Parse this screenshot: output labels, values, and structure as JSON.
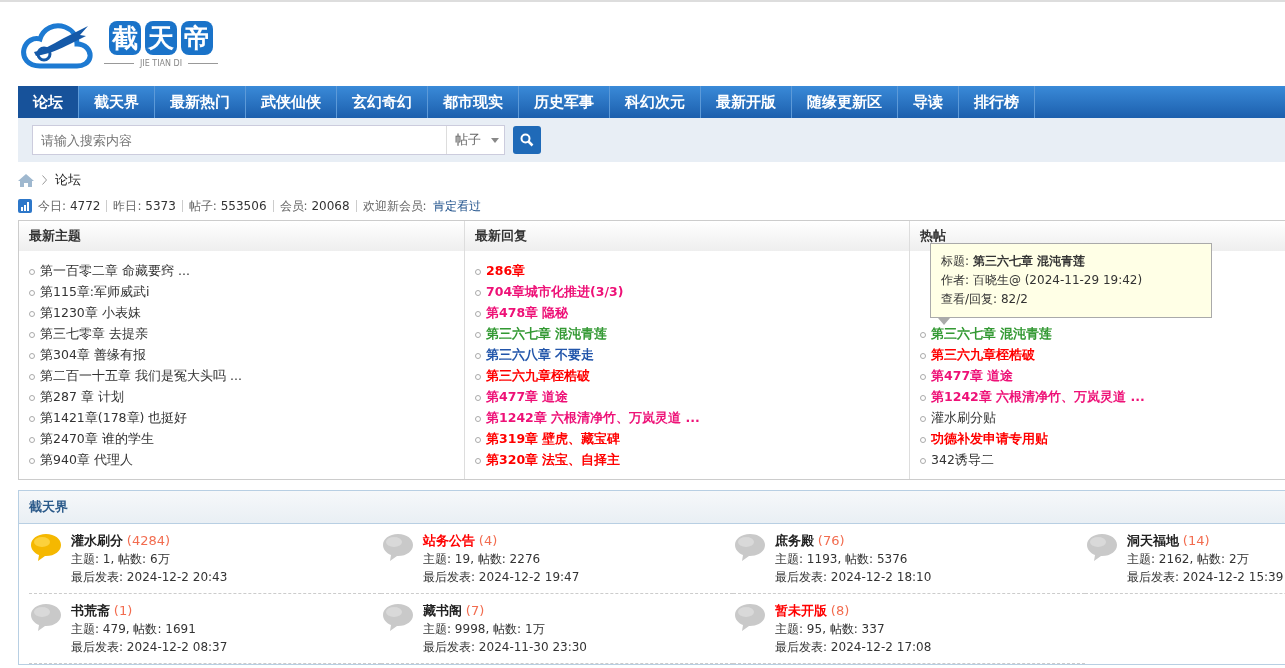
{
  "logo": {
    "chars": [
      "截",
      "天",
      "帝"
    ],
    "subtitle": "JIE TIAN DI"
  },
  "nav": [
    {
      "label": "论坛",
      "selected": true
    },
    {
      "label": "截天界",
      "selected": false
    },
    {
      "label": "最新热门",
      "selected": false
    },
    {
      "label": "武侠仙侠",
      "selected": false
    },
    {
      "label": "玄幻奇幻",
      "selected": false
    },
    {
      "label": "都市现实",
      "selected": false
    },
    {
      "label": "历史军事",
      "selected": false
    },
    {
      "label": "科幻次元",
      "selected": false
    },
    {
      "label": "最新开版",
      "selected": false
    },
    {
      "label": "随缘更新区",
      "selected": false
    },
    {
      "label": "导读",
      "selected": false
    },
    {
      "label": "排行榜",
      "selected": false
    }
  ],
  "search": {
    "placeholder": "请输入搜索内容",
    "scope": "帖子"
  },
  "breadcrumb": [
    "论坛"
  ],
  "stats": [
    {
      "label": "今日:",
      "value": "4772"
    },
    {
      "label": "昨日:",
      "value": "5373"
    },
    {
      "label": "帖子:",
      "value": "553506"
    },
    {
      "label": "会员:",
      "value": "20068"
    }
  ],
  "welcome": {
    "label": "欢迎新会员:",
    "member": "肯定看过"
  },
  "columns": [
    {
      "title": "最新主题",
      "items": [
        {
          "title": "第一百零二章 命藏要窍 ..."
        },
        {
          "title": "第115章:军师威武i"
        },
        {
          "title": "第1230章 小表妹"
        },
        {
          "title": "第三七零章 去提亲"
        },
        {
          "title": "第304章 善缘有报"
        },
        {
          "title": "第二百一十五章 我们是冤大头吗 ..."
        },
        {
          "title": "第287 章 计划"
        },
        {
          "title": "第1421章(178章) 也挺好"
        },
        {
          "title": "第2470章 谁的学生"
        },
        {
          "title": "第940章 代理人"
        }
      ]
    },
    {
      "title": "最新回复",
      "items": [
        {
          "title": "286章",
          "color": "#ff0000"
        },
        {
          "title": "704章城市化推进(3/3)",
          "color": "#ee1177"
        },
        {
          "title": "第478章 隐秘",
          "color": "#ee1177"
        },
        {
          "title": "第三六七章 混沌青莲",
          "color": "#339933"
        },
        {
          "title": "第三六八章 不要走",
          "color": "#2255aa"
        },
        {
          "title": "第三六九章桎梏破",
          "color": "#ff0000"
        },
        {
          "title": "第477章 道途",
          "color": "#ee1177"
        },
        {
          "title": "第1242章 六根清净竹、万岚灵道 ...",
          "color": "#ee1177"
        },
        {
          "title": "第319章 壁虎、藏宝碑",
          "color": "#ff0000"
        },
        {
          "title": "第320章 法宝、自择主",
          "color": "#ff0000"
        }
      ]
    },
    {
      "title": "热帖",
      "tooltip": {
        "title_label": "标题:",
        "title": "第三六七章 混沌青莲",
        "author_label": "作者:",
        "author": "百晓生@ (2024-11-29 19:42)",
        "views_label": "查看/回复:",
        "views": "82/2"
      },
      "items": [
        {
          "title": "第三六七章 混沌青莲",
          "color": "#339933"
        },
        {
          "title": "第三六九章桎梏破",
          "color": "#ff0000"
        },
        {
          "title": "第477章 道途",
          "color": "#ee1177"
        },
        {
          "title": "第1242章 六根清净竹、万岚灵道 ...",
          "color": "#ee1177"
        },
        {
          "title": "灌水刷分贴"
        },
        {
          "title": "功德补发申请专用贴",
          "color": "#ff0000"
        },
        {
          "title": "342诱导二"
        }
      ]
    }
  ],
  "section": {
    "title": "截天界",
    "forums": [
      {
        "name": "灌水刷分",
        "count": "(4284)",
        "new": true,
        "highlight": false,
        "stats": "主题: 1, 帖数: 6万",
        "last": "最后发表: 2024-12-2 20:43"
      },
      {
        "name": "站务公告",
        "count": "(4)",
        "new": false,
        "highlight": true,
        "stats": "主题: 19, 帖数: 2276",
        "last": "最后发表: 2024-12-2 19:47"
      },
      {
        "name": "庶务殿",
        "count": "(76)",
        "new": false,
        "highlight": false,
        "stats": "主题: 1193, 帖数: 5376",
        "last": "最后发表: 2024-12-2 18:10"
      },
      {
        "name": "洞天福地",
        "count": "(14)",
        "new": false,
        "highlight": false,
        "stats": "主题: 2162, 帖数: 2万",
        "last": "最后发表: 2024-12-2 15:39"
      },
      {
        "name": "书荒斋",
        "count": "(1)",
        "new": false,
        "highlight": false,
        "stats": "主题: 479, 帖数: 1691",
        "last": "最后发表: 2024-12-2 08:37"
      },
      {
        "name": "藏书阁",
        "count": "(7)",
        "new": false,
        "highlight": false,
        "stats": "主题: 9998, 帖数: 1万",
        "last": "最后发表: 2024-11-30 23:30"
      },
      {
        "name": "暂未开版",
        "count": "(8)",
        "new": false,
        "highlight": true,
        "stats": "主题: 95, 帖数: 337",
        "last": "最后发表: 2024-12-2 17:08"
      }
    ]
  }
}
